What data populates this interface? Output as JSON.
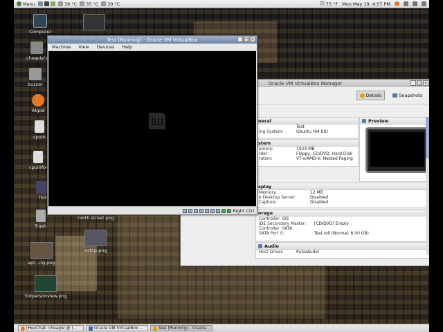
{
  "top_panel": {
    "menu_label": "Menu",
    "sensors": [
      "39 °C",
      "35 °C",
      "30 °C"
    ],
    "weather": "73 °F",
    "datetime": "Mon May 19,  4:57 PM"
  },
  "desktop_icons": [
    {
      "label": "Computer"
    },
    {
      "label": "cheapie's"
    },
    {
      "label": "buzzer"
    },
    {
      "label": "Algod"
    },
    {
      "label": "cpuin"
    },
    {
      "label": "cpuinfo-"
    },
    {
      "label": "TS3"
    },
    {
      "label": "Trash"
    },
    {
      "label": "north street.png"
    },
    {
      "label": "estop.png"
    },
    {
      "label": "apt...ng.png"
    },
    {
      "label": "3rdpersonview.png"
    }
  ],
  "vm_window": {
    "title": "Test [Running] - Oracle VM VirtualBox",
    "menus": [
      "Machine",
      "View",
      "Devices",
      "Help"
    ],
    "host_key": "Right Ctrl"
  },
  "manager_window": {
    "title": "Oracle VM VirtualBox Manager",
    "details_button": "Details",
    "snapshots_button": "Snapshots",
    "preview_title": "Preview",
    "general": {
      "title": "neral",
      "rows": [
        {
          "k": "",
          "v": "Test"
        },
        {
          "k": "ing System:",
          "v": "Ubuntu (64 bit)"
        }
      ]
    },
    "system": {
      "title": "stem",
      "rows": [
        {
          "k": "emory:",
          "v": "1024 MB"
        },
        {
          "k": "rder:",
          "v": "Floppy, CD/DVD, Hard Disk"
        },
        {
          "k": "ration:",
          "v": "VT-x/AMD-V, Nested Paging"
        }
      ]
    },
    "display": {
      "title": "splay",
      "rows": [
        {
          "k": "Memory:",
          "v": "12 MB"
        },
        {
          "k": "e Desktop Server:",
          "v": "Disabled"
        },
        {
          "k": "Capture:",
          "v": "Disabled"
        }
      ]
    },
    "storage": {
      "title": "orage",
      "rows": [
        {
          "k": "Controller: IDE",
          "v": ""
        },
        {
          "k": " IDE Secondary Master:",
          "v": "[CD/DVD] Empty"
        },
        {
          "k": "Controller: SATA",
          "v": ""
        },
        {
          "k": " SATA Port 0:",
          "v": "Test.vdi (Normal, 8.00 GB)"
        }
      ]
    },
    "audio": {
      "title": "Audio",
      "rows": [
        {
          "k": "Host Driver:",
          "v": "PulseAudio"
        }
      ]
    }
  },
  "taskbar": [
    {
      "label": "[HexChat: cheapie @ I..."
    },
    {
      "label": "Oracle VM VirtualBox ..."
    },
    {
      "label": "Test [Running] - Oracle..."
    }
  ]
}
